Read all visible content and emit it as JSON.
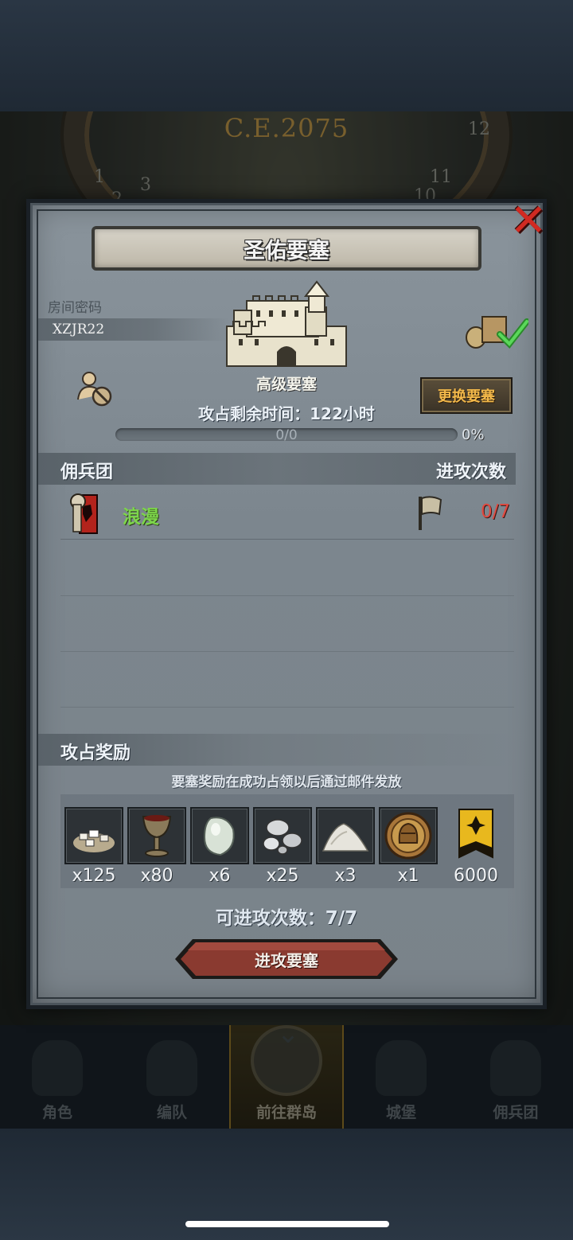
{
  "background": {
    "era": "C.E.2075",
    "dial_numbers": [
      "10",
      "11",
      "12",
      "1",
      "2",
      "3"
    ]
  },
  "dialog": {
    "title": "圣佑要塞",
    "room_code_label": "房间密码",
    "room_code": "XZJR22",
    "fortress_tier": "高级要塞",
    "change_button": "更换要塞",
    "remaining_time_label": "攻占剩余时间：",
    "remaining_time_value": "122小时",
    "progress": {
      "fraction": 0.0,
      "text": "0/0",
      "percent": "0%"
    },
    "mercenary_header": "佣兵团",
    "attacks_header": "进攻次数",
    "mercenaries": [
      {
        "name": "浪漫",
        "attacks": "0/7"
      }
    ],
    "rewards_header": "攻占奖励",
    "reward_note": "要塞奖励在成功占领以后通过邮件发放",
    "rewards": [
      {
        "icon": "ore-pile-icon",
        "qty": "x125"
      },
      {
        "icon": "goblet-icon",
        "qty": "x80"
      },
      {
        "icon": "moonstone-icon",
        "qty": "x6"
      },
      {
        "icon": "silver-orbs-icon",
        "qty": "x25"
      },
      {
        "icon": "salt-pile-icon",
        "qty": "x3"
      },
      {
        "icon": "knight-medal-icon",
        "qty": "x1"
      },
      {
        "icon": "guild-banner-icon",
        "qty": "6000"
      }
    ],
    "attacks_left_label": "可进攻次数：",
    "attacks_left_value": "7/7",
    "attack_button": "进攻要塞"
  },
  "bottom_nav": [
    {
      "label": "角色",
      "active": false
    },
    {
      "label": "编队",
      "active": false
    },
    {
      "label": "前往群岛",
      "active": true
    },
    {
      "label": "城堡",
      "active": false
    },
    {
      "label": "佣兵团",
      "active": false
    }
  ],
  "colors": {
    "close": "#d12a22",
    "merc_name": "#7dd64a",
    "attacks_used": "#e04a40",
    "change_button_text": "#f2b84a",
    "attack_button": "#8a3a30"
  }
}
